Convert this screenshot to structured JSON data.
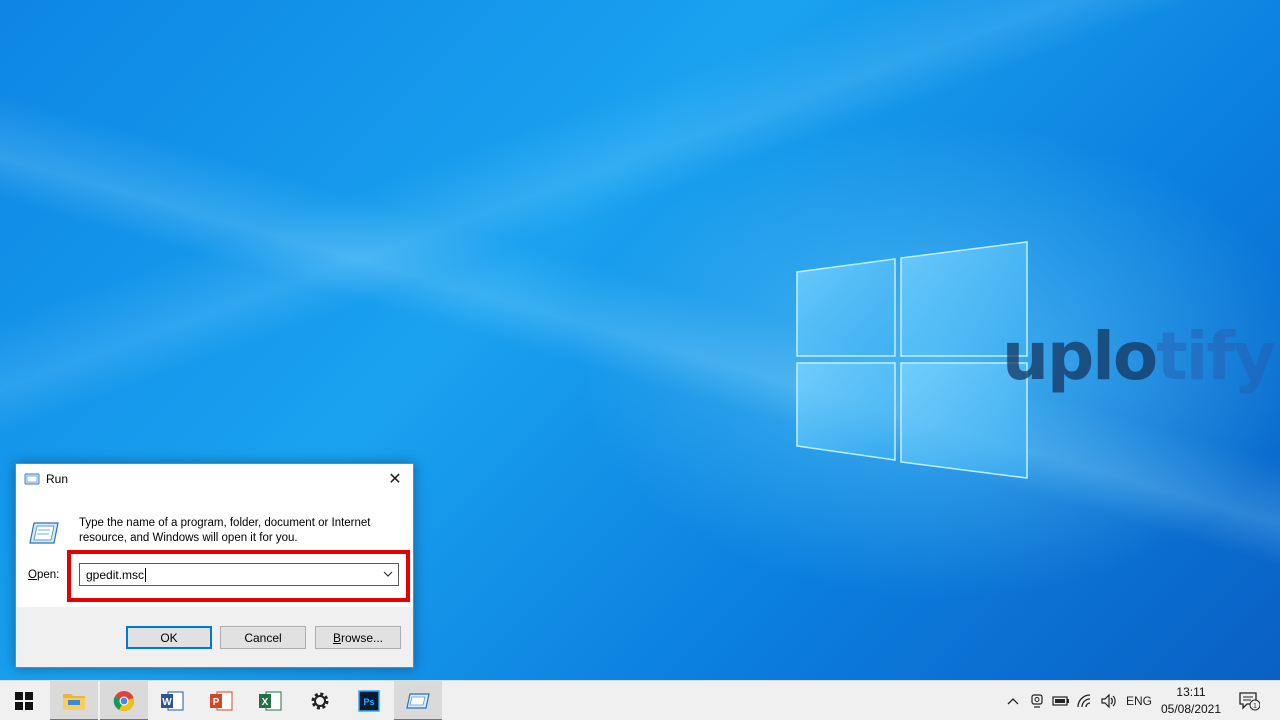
{
  "desktop": {
    "watermark_main": "uplo",
    "watermark_fade": "tify"
  },
  "run_dialog": {
    "title": "Run",
    "close_glyph": "✕",
    "description": "Type the name of a program, folder, document or Internet resource, and Windows will open it for you.",
    "open_label_accel": "O",
    "open_label_rest": "pen:",
    "open_value": "gpedit.msc",
    "buttons": {
      "ok": "OK",
      "cancel": "Cancel",
      "browse_accel": "B",
      "browse_rest": "rowse..."
    },
    "highlight_color": "#e60000"
  },
  "taskbar": {
    "pinned": [
      "start-icon",
      "file-explorer-icon",
      "chrome-icon",
      "word-icon",
      "powerpoint-icon",
      "excel-icon",
      "settings-icon",
      "photoshop-icon",
      "run-app-icon"
    ],
    "tray": {
      "language": "ENG",
      "notification_count": "1"
    },
    "clock": {
      "time": "13:11",
      "date": "05/08/2021"
    }
  }
}
